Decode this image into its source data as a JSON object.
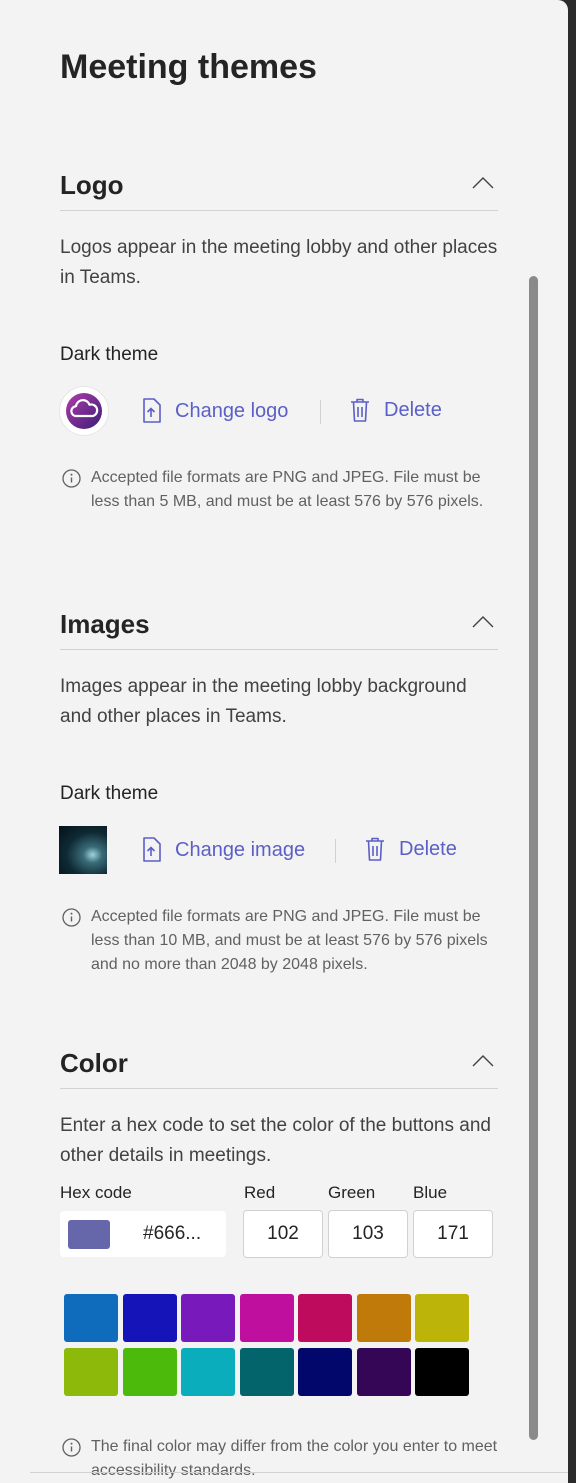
{
  "page_title": "Meeting themes",
  "logo_section": {
    "title": "Logo",
    "description": "Logos appear in the meeting lobby and other places in Teams.",
    "theme_label": "Dark theme",
    "change_label": "Change logo",
    "delete_label": "Delete",
    "note": "Accepted file formats are PNG and JPEG. File must be less than 5 MB, and must be at least 576 by 576 pixels."
  },
  "images_section": {
    "title": "Images",
    "description": "Images appear in the meeting lobby background and other places in Teams.",
    "theme_label": "Dark theme",
    "change_label": "Change image",
    "delete_label": "Delete",
    "note": "Accepted file formats are PNG and JPEG. File must be less than 10 MB, and must be at least 576 by 576 pixels and no more than 2048 by 2048 pixels."
  },
  "color_section": {
    "title": "Color",
    "description": "Enter a hex code to set the color of the buttons and other details in meetings.",
    "hex_label": "Hex code",
    "hex_value": "#666...",
    "red_label": "Red",
    "green_label": "Green",
    "blue_label": "Blue",
    "red_value": "102",
    "green_value": "103",
    "blue_value": "171",
    "current_color": "#6667ab",
    "palette": [
      "#0f6cbd",
      "#1414b8",
      "#7719bb",
      "#bf0f9f",
      "#bf0b5e",
      "#bf7a0a",
      "#bdb40a",
      "#8db90b",
      "#4bba0a",
      "#0aadbb",
      "#03656b",
      "#02076b",
      "#350656",
      "#000000"
    ],
    "note": "The final color may differ from the color you enter to meet accessibility standards."
  },
  "colors": {
    "accent": "#5b5fc7",
    "panel_bg": "#f3f3f3"
  }
}
